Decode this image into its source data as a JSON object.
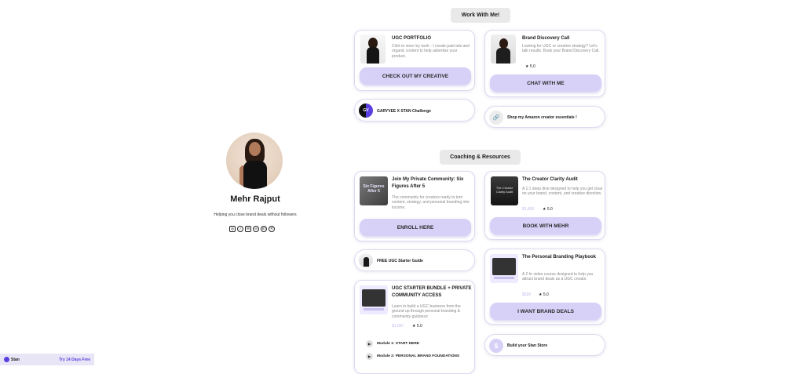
{
  "profile": {
    "name": "Mehr Rajput",
    "bio": "Helping you close brand deals without followers",
    "socials": [
      {
        "icon": "instagram-icon",
        "glyph": "◎"
      },
      {
        "icon": "tiktok-icon",
        "glyph": "♪"
      },
      {
        "icon": "email-icon",
        "glyph": "✉"
      },
      {
        "icon": "link-icon",
        "glyph": "∞"
      },
      {
        "icon": "linkedin-icon",
        "glyph": "in"
      },
      {
        "icon": "x-icon",
        "glyph": "✕"
      }
    ]
  },
  "sections": {
    "work": "Work With Me!",
    "coaching": "Coaching & Resources"
  },
  "cards": {
    "portfolio": {
      "title": "UGC PORTFOLIO",
      "desc": "Click to view my work - I create paid ads and organic content to help advertise your product.",
      "cta": "CHECK OUT MY CREATIVE"
    },
    "discovery": {
      "title": "Brand Discovery Call",
      "desc": "Looking for UGC or creative strategy? Let's talk results. Book your Brand Discovery Call.",
      "rating": "5.0",
      "cta": "CHAT WITH ME"
    },
    "community": {
      "title": "Join My Private Community: Six Figures After 5",
      "thumb_text": "Six Figures After 5",
      "desc": "The community for creators ready to turn content, strategy, and personal branding into income.",
      "cta": "ENROLL HERE"
    },
    "clarity": {
      "title": "The Creator Clarity Audit",
      "thumb_text": "The Creator Clarity Audit",
      "desc": "A 1:1 deep dive designed to help you get clear on your brand, content, and creative direction.",
      "price": "$1,800",
      "rating": "5.0",
      "cta": "BOOK WITH MEHR"
    },
    "playbook": {
      "title": "The Personal Branding Playbook",
      "desc": "A 2 hr video course designed to help you attract brand deals as a UGC creator.",
      "price": "$330",
      "rating": "5.0",
      "cta": "I WANT BRAND DEALS"
    },
    "bundle": {
      "title": "UGC STARTER BUNDLE + PRIVATE COMMUNITY ACCESS",
      "desc": "Learn to build a UGC business from the ground up through personal branding & community guidance",
      "price": "$1,697",
      "rating": "5.0",
      "modules": [
        "Module 1: START HERE",
        "Module 2: PERSONAL BRAND FOUNDATIONS"
      ]
    }
  },
  "links": {
    "garyvee": {
      "label": "GARYVEE X STAN Challenge",
      "icon": "garyvee-logo-icon",
      "icon_text": "GV"
    },
    "amazon": {
      "label": "Shop my Amazon creator essentials !",
      "icon": "link-icon",
      "glyph": "🔗"
    },
    "guide": {
      "label": "FREE UGC Starter Guide"
    },
    "store": {
      "label": "Build your Stan Store",
      "glyph": "$"
    }
  },
  "footer": {
    "brand": "Stan",
    "trial": "Try 14 Days Free"
  },
  "colors": {
    "accent": "#d7d0f7",
    "brand": "#5b3fe0",
    "card_border": "#dcd9ef"
  }
}
